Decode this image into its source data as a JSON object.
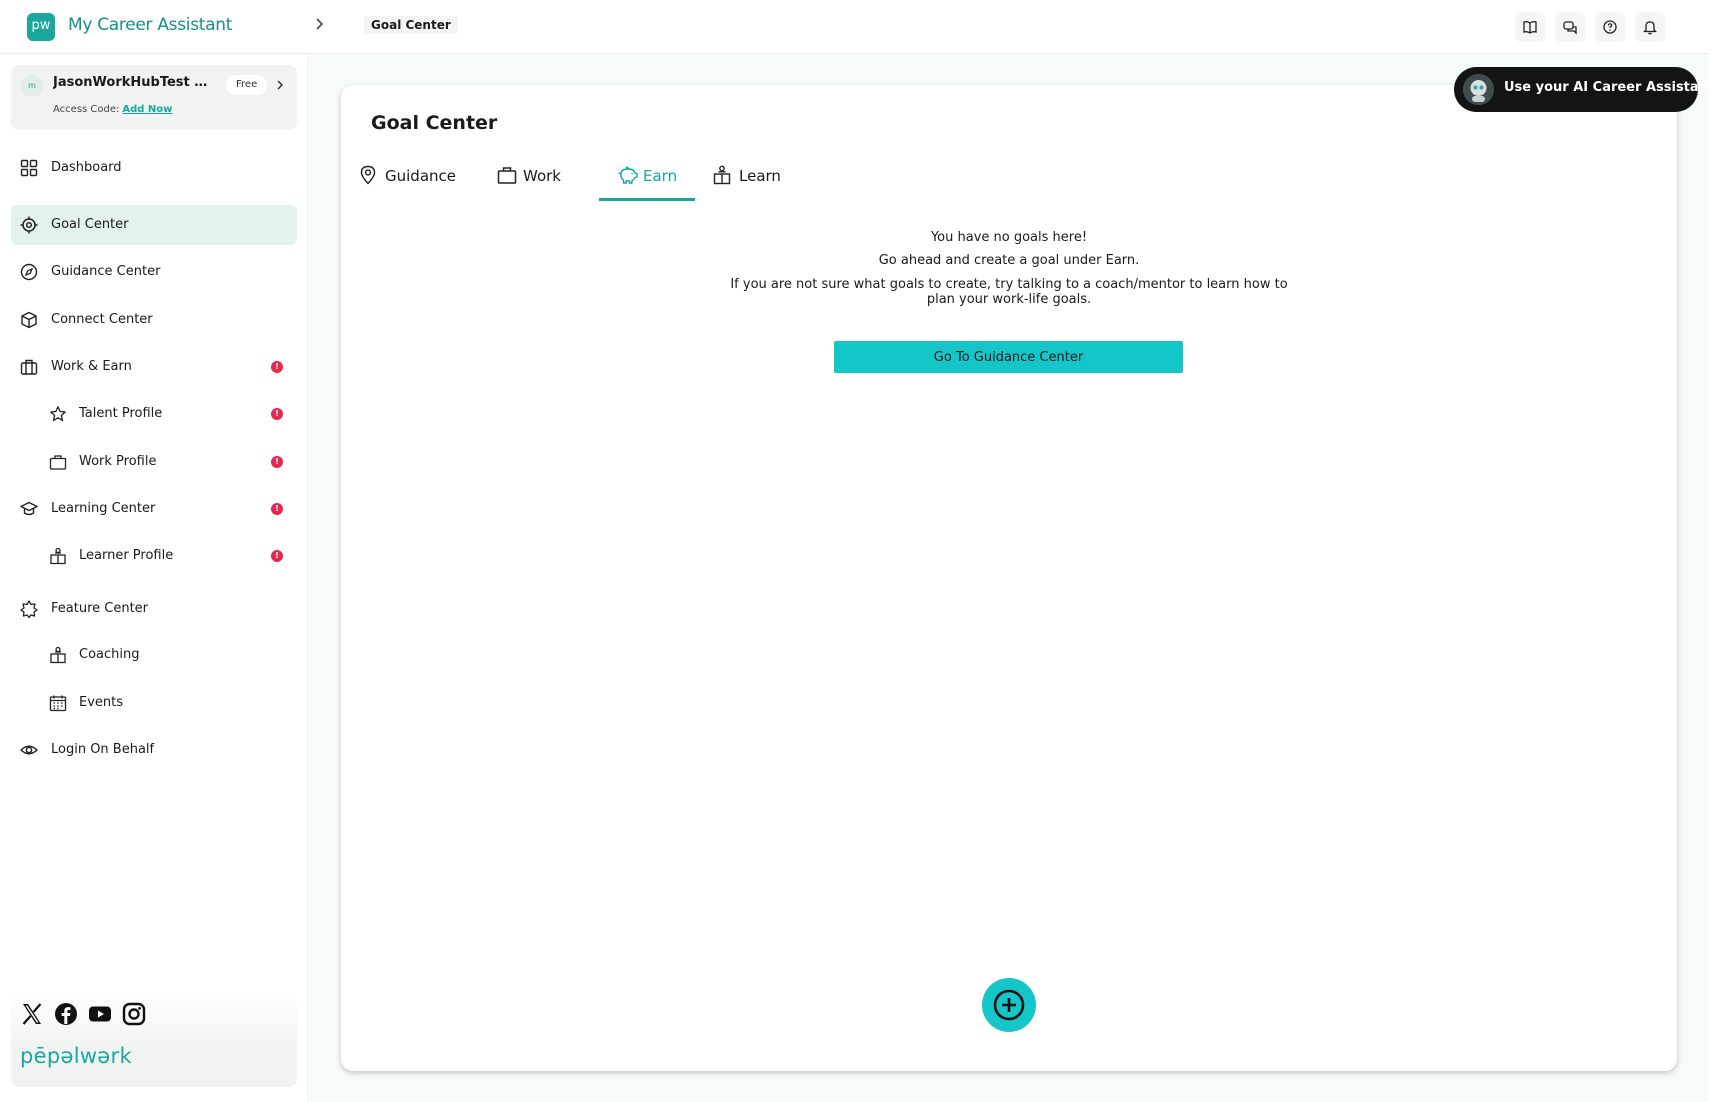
{
  "header": {
    "logo_text": "pw",
    "app_title": "My Career Assistant",
    "breadcrumb_current": "Goal Center",
    "icons": [
      "book-icon",
      "chat-icon",
      "help-icon",
      "bell-icon"
    ]
  },
  "sidebar": {
    "user": {
      "avatar_text": "m",
      "name": "JasonWorkHubTest Leib...",
      "plan": "Free",
      "access_code_label": "Access Code:",
      "access_code_link": "Add Now"
    },
    "items": [
      {
        "label": "Dashboard",
        "icon": "grid-icon"
      },
      {
        "label": "Goal Center",
        "icon": "target-icon",
        "active": true
      },
      {
        "label": "Guidance Center",
        "icon": "compass-icon"
      },
      {
        "label": "Connect Center",
        "icon": "cube-icon"
      },
      {
        "label": "Work & Earn",
        "icon": "briefcase-icon",
        "alert": "!"
      },
      {
        "label": "Talent Profile",
        "icon": "star-icon",
        "alert": "!"
      },
      {
        "label": "Work Profile",
        "icon": "work-bag-icon",
        "alert": "!"
      },
      {
        "label": "Learning Center",
        "icon": "graduation-cap-icon",
        "alert": "!"
      },
      {
        "label": "Learner Profile",
        "icon": "learner-icon",
        "alert": "!"
      },
      {
        "label": "Feature Center",
        "icon": "badge-star-icon"
      },
      {
        "label": "Coaching",
        "icon": "coaching-icon"
      },
      {
        "label": "Events",
        "icon": "calendar-icon"
      },
      {
        "label": "Login On Behalf",
        "icon": "eye-icon"
      }
    ],
    "footer": {
      "social_icons": [
        "x-icon",
        "facebook-icon",
        "youtube-icon",
        "instagram-icon"
      ],
      "brand": "pēpəlwərk"
    }
  },
  "main": {
    "title": "Goal Center",
    "tabs": [
      {
        "label": "Guidance",
        "icon": "pin-icon"
      },
      {
        "label": "Work",
        "icon": "work-bag-icon"
      },
      {
        "label": "Earn",
        "icon": "piggy-bank-icon",
        "active": true
      },
      {
        "label": "Learn",
        "icon": "learner-icon"
      }
    ],
    "empty_state": {
      "line1": "You have no goals here!",
      "line2": "Go ahead and create a goal under Earn.",
      "line3": "If you are not sure what goals to create, try talking to a coach/mentor to learn how to plan your work-life goals.",
      "button": "Go To Guidance Center"
    }
  },
  "ai_assistant": {
    "label": "Use your AI Career Assistant"
  },
  "colors": {
    "brand": "#1aa79c",
    "accent_button": "#15c6c8",
    "alert": "#e5284e",
    "active_nav_bg": "#e3f1ef"
  }
}
